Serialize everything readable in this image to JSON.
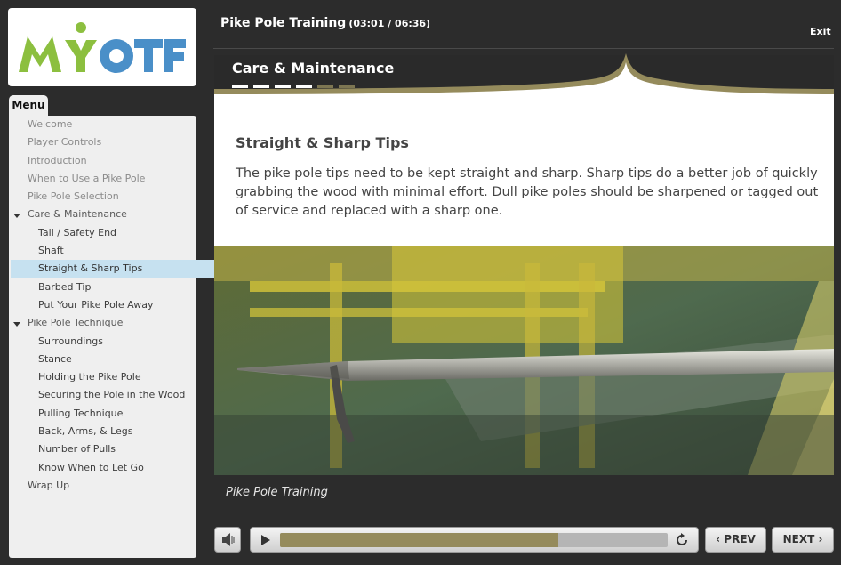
{
  "course": {
    "title": "Pike Pole Training",
    "time": "(03:01 / 06:36)",
    "exit_label": "Exit"
  },
  "logo": {
    "text": "MYOTF",
    "colors": {
      "green": "#8cbf3f",
      "blue": "#4a8fc8"
    }
  },
  "menu": {
    "tab_label": "Menu",
    "items": [
      {
        "label": "Welcome"
      },
      {
        "label": "Player Controls"
      },
      {
        "label": "Introduction"
      },
      {
        "label": "When to Use a Pike Pole"
      },
      {
        "label": "Pike Pole Selection"
      },
      {
        "label": "Care & Maintenance"
      },
      {
        "label": "Tail / Safety End"
      },
      {
        "label": "Shaft"
      },
      {
        "label": "Straight & Sharp Tips"
      },
      {
        "label": "Barbed Tip"
      },
      {
        "label": "Put Your Pike Pole Away"
      },
      {
        "label": "Pike Pole Technique"
      },
      {
        "label": "Surroundings"
      },
      {
        "label": "Stance"
      },
      {
        "label": "Holding the Pike Pole"
      },
      {
        "label": "Securing the Pole in the Wood"
      },
      {
        "label": "Pulling Technique"
      },
      {
        "label": "Back, Arms, & Legs"
      },
      {
        "label": "Number of Pulls"
      },
      {
        "label": "Know When to Let Go"
      },
      {
        "label": "Wrap Up"
      }
    ],
    "active_item": "Straight & Sharp Tips"
  },
  "section": {
    "title": "Care & Maintenance",
    "progress": {
      "completed": 4,
      "total": 6
    }
  },
  "content": {
    "heading": "Straight & Sharp Tips",
    "body": "The pike pole tips need to be kept straight and sharp. Sharp tips do a better job of quickly grabbing the wood with minimal effort. Dull pike poles should be sharpened or tagged out of service and replaced with a sharp one."
  },
  "caption": "Pike Pole Training",
  "player": {
    "progress_fraction": 0.718,
    "prev_label": "PREV",
    "next_label": "NEXT"
  },
  "colors": {
    "accent_gold": "#958b5c",
    "active_menu": "#c6e1f0",
    "background": "#2c2c2c"
  }
}
